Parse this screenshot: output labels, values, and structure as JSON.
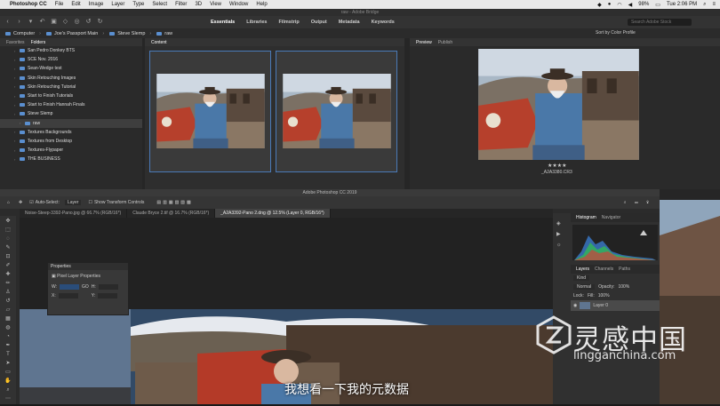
{
  "menubar": {
    "app_name": "Photoshop CC",
    "items": [
      "File",
      "Edit",
      "Image",
      "Layer",
      "Type",
      "Select",
      "Filter",
      "3D",
      "View",
      "Window",
      "Help"
    ],
    "battery": "98%",
    "clock": "Tue 2:06 PM"
  },
  "bridge": {
    "title": "raw - Adobe Bridge",
    "workspaces": [
      "Essentials",
      "Libraries",
      "Filmstrip",
      "Output",
      "Metadata",
      "Keywords"
    ],
    "active_workspace": "Essentials",
    "sort_label": "Sort by Color Profile",
    "search_placeholder": "Search Adobe Stock",
    "path": [
      "Computer",
      "Joe's Passport Main",
      "Steve Slemp",
      "raw"
    ],
    "panel_tabs": [
      "Favorites",
      "Folders"
    ],
    "content_tab": "Content",
    "preview_tabs": [
      "Preview",
      "Publish"
    ],
    "folders": [
      {
        "label": "San Pedro Donkey BTS",
        "state": "normal"
      },
      {
        "label": "SCE Nov. 2016",
        "state": "normal"
      },
      {
        "label": "Sean-Wedge test",
        "state": "normal"
      },
      {
        "label": "Skin Retouching Images",
        "state": "normal"
      },
      {
        "label": "Skin Retouching Tutorial",
        "state": "normal"
      },
      {
        "label": "Start to Finish Tutorials",
        "state": "normal"
      },
      {
        "label": "Start to Finish Hannah Finals",
        "state": "normal"
      },
      {
        "label": "Steve Slemp",
        "state": "normal"
      },
      {
        "label": "raw",
        "state": "selected"
      },
      {
        "label": "Textures Backgrounds",
        "state": "normal"
      },
      {
        "label": "Textures from Desktop",
        "state": "normal"
      },
      {
        "label": "Textures-Flypaper",
        "state": "normal"
      },
      {
        "label": "THE BUSINESS",
        "state": "normal"
      }
    ],
    "thumb_stars": [
      "★★★★",
      "★★★★"
    ],
    "preview_stars": "★★★★",
    "preview_filename": "_A2A3380.CR3"
  },
  "photoshop": {
    "title": "Adobe Photoshop CC 2019",
    "options": {
      "auto_select": "Auto-Select:",
      "layer": "Layer",
      "transform": "Show Transform Controls"
    },
    "doc_tabs": [
      "Noise-Steep-3392-Pano.jpg @ 66.7% (RGB/16*)",
      "Claude Bryce 2.tif @ 16.7% (RGB/16*)",
      "_A2A3392-Pano 2.dng @ 12.5% (Layer 0, RGB/16*)"
    ],
    "active_doc": 2,
    "properties": {
      "title": "Properties",
      "subtitle": "Pixel Layer Properties",
      "w_label": "W:",
      "h_label": "H:",
      "go_label": "GO",
      "x_label": "X:",
      "y_label": "Y:"
    },
    "histogram_tabs": [
      "Histogram",
      "Navigator"
    ],
    "layers_tabs": [
      "Layers",
      "Channels",
      "Paths"
    ],
    "layers": {
      "kind": "Kind",
      "blend": "Normal",
      "opacity_label": "Opacity:",
      "opacity": "100%",
      "lock_label": "Lock:",
      "fill_label": "Fill:",
      "fill": "100%",
      "layer_name": "Layer 0"
    }
  },
  "subtitle": "我想看一下我的元数据",
  "watermark": {
    "cn": "灵感中国",
    "url": "lingganchina.com"
  }
}
